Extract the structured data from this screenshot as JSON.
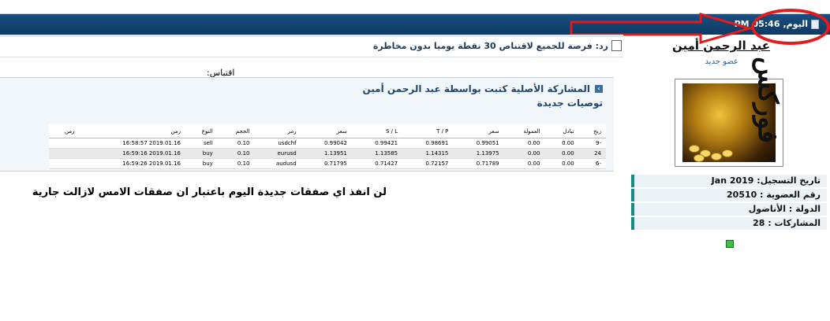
{
  "header": {
    "date_label": "اليوم,",
    "time": "05:46 PM"
  },
  "post": {
    "title": "رد: فرصة للجميع لاقتناص 30 نقطة يوميا بدون مخاطرة",
    "quote_label": "اقتباس:",
    "original_by": "المشاركة الأصلية كتبت بواسطة عبد الرحمن أمين",
    "quote_title": "توصيات جديدة",
    "body_text": "لن انفذ اي صفقات جديدة اليوم باعتبار ان صفقات الامس لازالت جارية"
  },
  "table": {
    "columns": [
      "ربح",
      "تبادل",
      "العمولة",
      "سعر",
      "T / P",
      "S / L",
      "سعر",
      "رمز",
      "الحجم",
      "النوع",
      "زمن",
      "زمن"
    ],
    "rows": [
      [
        "-9",
        "0.00",
        "0.00",
        "0.99051",
        "0.98691",
        "0.99421",
        "0.99042",
        "usdchf",
        "0.10",
        "sell",
        "2019.01.16 16:58:57",
        ""
      ],
      [
        "24",
        "0.00",
        "0.00",
        "1.13975",
        "1.14315",
        "1.13585",
        "1.13951",
        "eurusd",
        "0.10",
        "buy",
        "2019.01.16 16:59:16",
        ""
      ],
      [
        "-6",
        "0.00",
        "0.00",
        "0.71789",
        "0.72157",
        "0.71427",
        "0.71795",
        "audusd",
        "0.10",
        "buy",
        "2019.01.16 16:59:26",
        ""
      ]
    ]
  },
  "user": {
    "name": "عبد الرحمن أمين",
    "title": "عضو جديد",
    "avatar_text": "فوركس",
    "info": [
      "تاريخ التسجيل: Jan 2019",
      "رقم العضوية : 20510",
      "الدولة : الأناضول",
      "المشاركات : 28"
    ]
  },
  "colors": {
    "header_bar": "#0d3a63",
    "annotation": "#e21b1b",
    "info_accent": "#1a8a83",
    "online": "#3bc13b"
  }
}
